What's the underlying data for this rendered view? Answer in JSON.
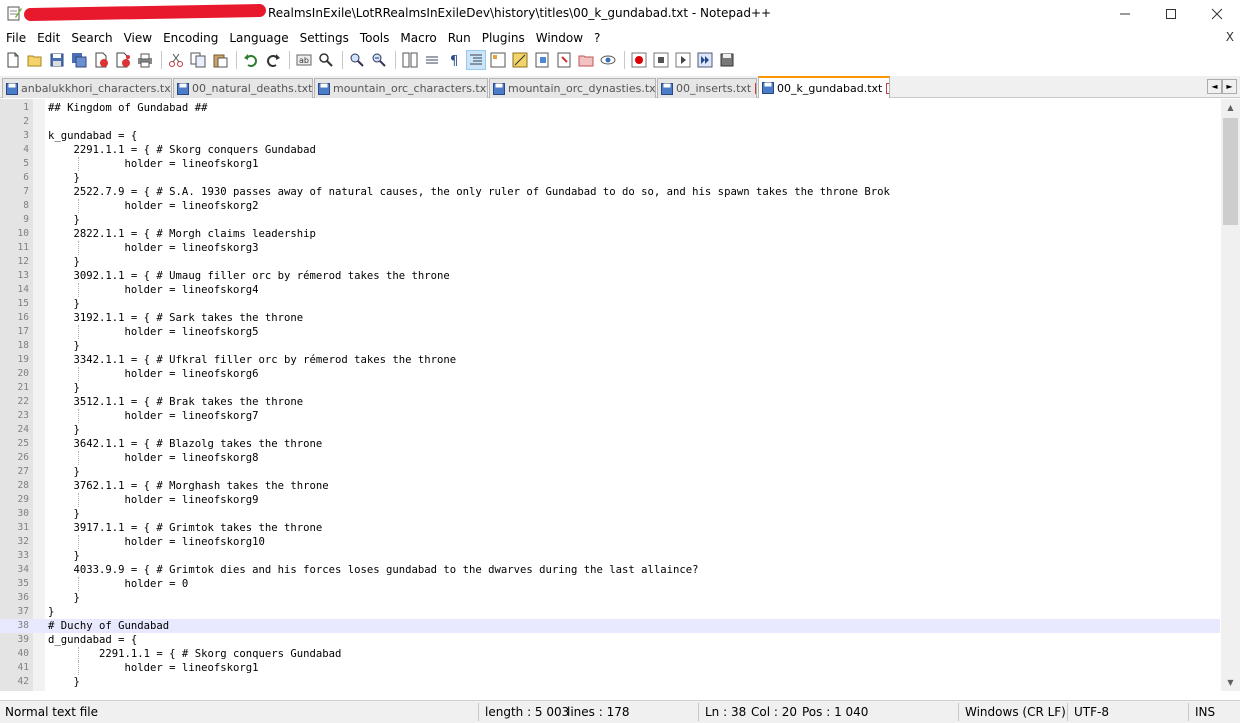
{
  "window": {
    "title": "RealmsInExile\\LotRRealmsInExileDev\\history\\titles\\00_k_gundabad.txt - Notepad++",
    "minimize_label": "—",
    "maximize_label": "☐",
    "close_label": "✕"
  },
  "menu": {
    "items": [
      "File",
      "Edit",
      "Search",
      "View",
      "Encoding",
      "Language",
      "Settings",
      "Tools",
      "Macro",
      "Run",
      "Plugins",
      "Window",
      "?"
    ],
    "close_label": "X"
  },
  "toolbar": {
    "icons": [
      "new-file-icon",
      "open-file-icon",
      "save-icon",
      "save-all-icon",
      "close-icon",
      "close-all-icon",
      "print-icon",
      "cut-icon",
      "copy-icon",
      "paste-icon",
      "undo-icon",
      "redo-icon",
      "find-icon",
      "replace-icon",
      "zoom-in-icon",
      "zoom-out-icon",
      "sync-vertical-icon",
      "sync-horizontal-icon",
      "word-wrap-icon",
      "show-all-characters-icon",
      "indent-guide-icon",
      "user-language-icon",
      "doc-map-icon",
      "function-list-icon",
      "folder-workspace-icon",
      "monitoring-icon",
      "record-macro-icon",
      "stop-macro-icon",
      "play-macro-icon",
      "run-macro-multiple-icon",
      "save-macro-icon"
    ]
  },
  "tabs": [
    {
      "label": "anbalukkhori_characters.txt",
      "active": false
    },
    {
      "label": "00_natural_deaths.txt",
      "active": false
    },
    {
      "label": "mountain_orc_characters.txt",
      "active": false
    },
    {
      "label": "mountain_orc_dynasties.txt",
      "active": false
    },
    {
      "label": "00_inserts.txt",
      "active": false
    },
    {
      "label": "00_k_gundabad.txt",
      "active": true
    }
  ],
  "tab_scroll": {
    "left": "◄",
    "right": "►"
  },
  "scrollbar": {
    "up": "▲",
    "down": "▼"
  },
  "editor": {
    "current_line": 38,
    "lines": [
      {
        "n": "1",
        "text": "## Kingdom of Gundabad ##"
      },
      {
        "n": "2",
        "text": ""
      },
      {
        "n": "3",
        "text": "k_gundabad = {"
      },
      {
        "n": "4",
        "text": "    2291.1.1 = { # Skorg conquers Gundabad"
      },
      {
        "n": "5",
        "text": "            holder = lineofskorg1"
      },
      {
        "n": "6",
        "text": "    }"
      },
      {
        "n": "7",
        "text": "    2522.7.9 = { # S.A. 1930 passes away of natural causes, the only ruler of Gundabad to do so, and his spawn takes the throne Brok"
      },
      {
        "n": "8",
        "text": "            holder = lineofskorg2"
      },
      {
        "n": "9",
        "text": "    }"
      },
      {
        "n": "10",
        "text": "    2822.1.1 = { # Morgh claims leadership"
      },
      {
        "n": "11",
        "text": "            holder = lineofskorg3"
      },
      {
        "n": "12",
        "text": "    }"
      },
      {
        "n": "13",
        "text": "    3092.1.1 = { # Umaug filler orc by rémerod takes the throne"
      },
      {
        "n": "14",
        "text": "            holder = lineofskorg4"
      },
      {
        "n": "15",
        "text": "    }"
      },
      {
        "n": "16",
        "text": "    3192.1.1 = { # Sark takes the throne"
      },
      {
        "n": "17",
        "text": "            holder = lineofskorg5"
      },
      {
        "n": "18",
        "text": "    }"
      },
      {
        "n": "19",
        "text": "    3342.1.1 = { # Ufkral filler orc by rémerod takes the throne"
      },
      {
        "n": "20",
        "text": "            holder = lineofskorg6"
      },
      {
        "n": "21",
        "text": "    }"
      },
      {
        "n": "22",
        "text": "    3512.1.1 = { # Brak takes the throne"
      },
      {
        "n": "23",
        "text": "            holder = lineofskorg7"
      },
      {
        "n": "24",
        "text": "    }"
      },
      {
        "n": "25",
        "text": "    3642.1.1 = { # Blazolg takes the throne"
      },
      {
        "n": "26",
        "text": "            holder = lineofskorg8"
      },
      {
        "n": "27",
        "text": "    }"
      },
      {
        "n": "28",
        "text": "    3762.1.1 = { # Morghash takes the throne"
      },
      {
        "n": "29",
        "text": "            holder = lineofskorg9"
      },
      {
        "n": "30",
        "text": "    }"
      },
      {
        "n": "31",
        "text": "    3917.1.1 = { # Grimtok takes the throne"
      },
      {
        "n": "32",
        "text": "            holder = lineofskorg10"
      },
      {
        "n": "33",
        "text": "    }"
      },
      {
        "n": "34",
        "text": "    4033.9.9 = { # Grimtok dies and his forces loses gundabad to the dwarves during the last allaince?"
      },
      {
        "n": "35",
        "text": "            holder = 0"
      },
      {
        "n": "36",
        "text": "    }"
      },
      {
        "n": "37",
        "text": "}"
      },
      {
        "n": "38",
        "text": "# Duchy of Gundabad"
      },
      {
        "n": "39",
        "text": "d_gundabad = {"
      },
      {
        "n": "40",
        "text": "        2291.1.1 = { # Skorg conquers Gundabad"
      },
      {
        "n": "41",
        "text": "            holder = lineofskorg1"
      },
      {
        "n": "42",
        "text": "    }"
      }
    ]
  },
  "status": {
    "file_type": "Normal text file",
    "length": "length : 5 003",
    "lines": "lines : 178",
    "ln": "Ln : 38",
    "col": "Col : 20",
    "pos": "Pos : 1 040",
    "eol": "Windows (CR LF)",
    "encoding": "UTF-8",
    "mode": "INS"
  },
  "colors": {
    "active_tab_accent": "#fa9600",
    "current_line_bg": "#e8e8ff",
    "gutter_bg": "#e4e4e4",
    "redaction": "#e8192c"
  }
}
